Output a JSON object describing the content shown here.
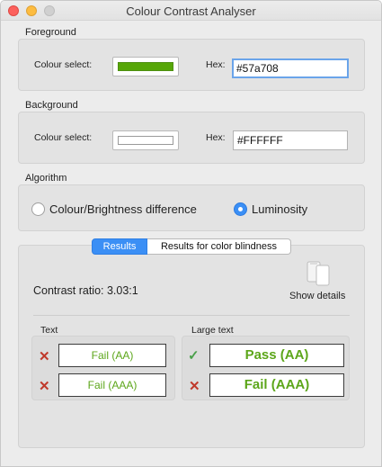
{
  "window": {
    "title": "Colour Contrast Analyser"
  },
  "foreground": {
    "section_label": "Foreground",
    "colour_select_label": "Colour select:",
    "hex_label": "Hex:",
    "hex_value": "#57a708",
    "swatch_color": "#57a708"
  },
  "background": {
    "section_label": "Background",
    "colour_select_label": "Colour select:",
    "hex_label": "Hex:",
    "hex_value": "#FFFFFF",
    "swatch_color": "#FFFFFF"
  },
  "algorithm": {
    "section_label": "Algorithm",
    "options": [
      {
        "label": "Colour/Brightness difference",
        "selected": false
      },
      {
        "label": "Luminosity",
        "selected": true
      }
    ]
  },
  "results": {
    "tabs": [
      {
        "label": "Results",
        "active": true
      },
      {
        "label": "Results for color blindness",
        "active": false
      }
    ],
    "contrast_ratio": "Contrast ratio: 3.03:1",
    "show_details_label": "Show details",
    "text_label": "Text",
    "large_text_label": "Large text",
    "text_results": [
      {
        "label": "Fail (AA)",
        "icon": "fail-x-icon"
      },
      {
        "label": "Fail (AAA)",
        "icon": "fail-x-icon"
      }
    ],
    "large_text_results": [
      {
        "label": "Pass (AA)",
        "icon": "pass-check-icon"
      },
      {
        "label": "Fail (AAA)",
        "icon": "fail-x-icon"
      }
    ],
    "result_text_color": "#5ca61a"
  }
}
